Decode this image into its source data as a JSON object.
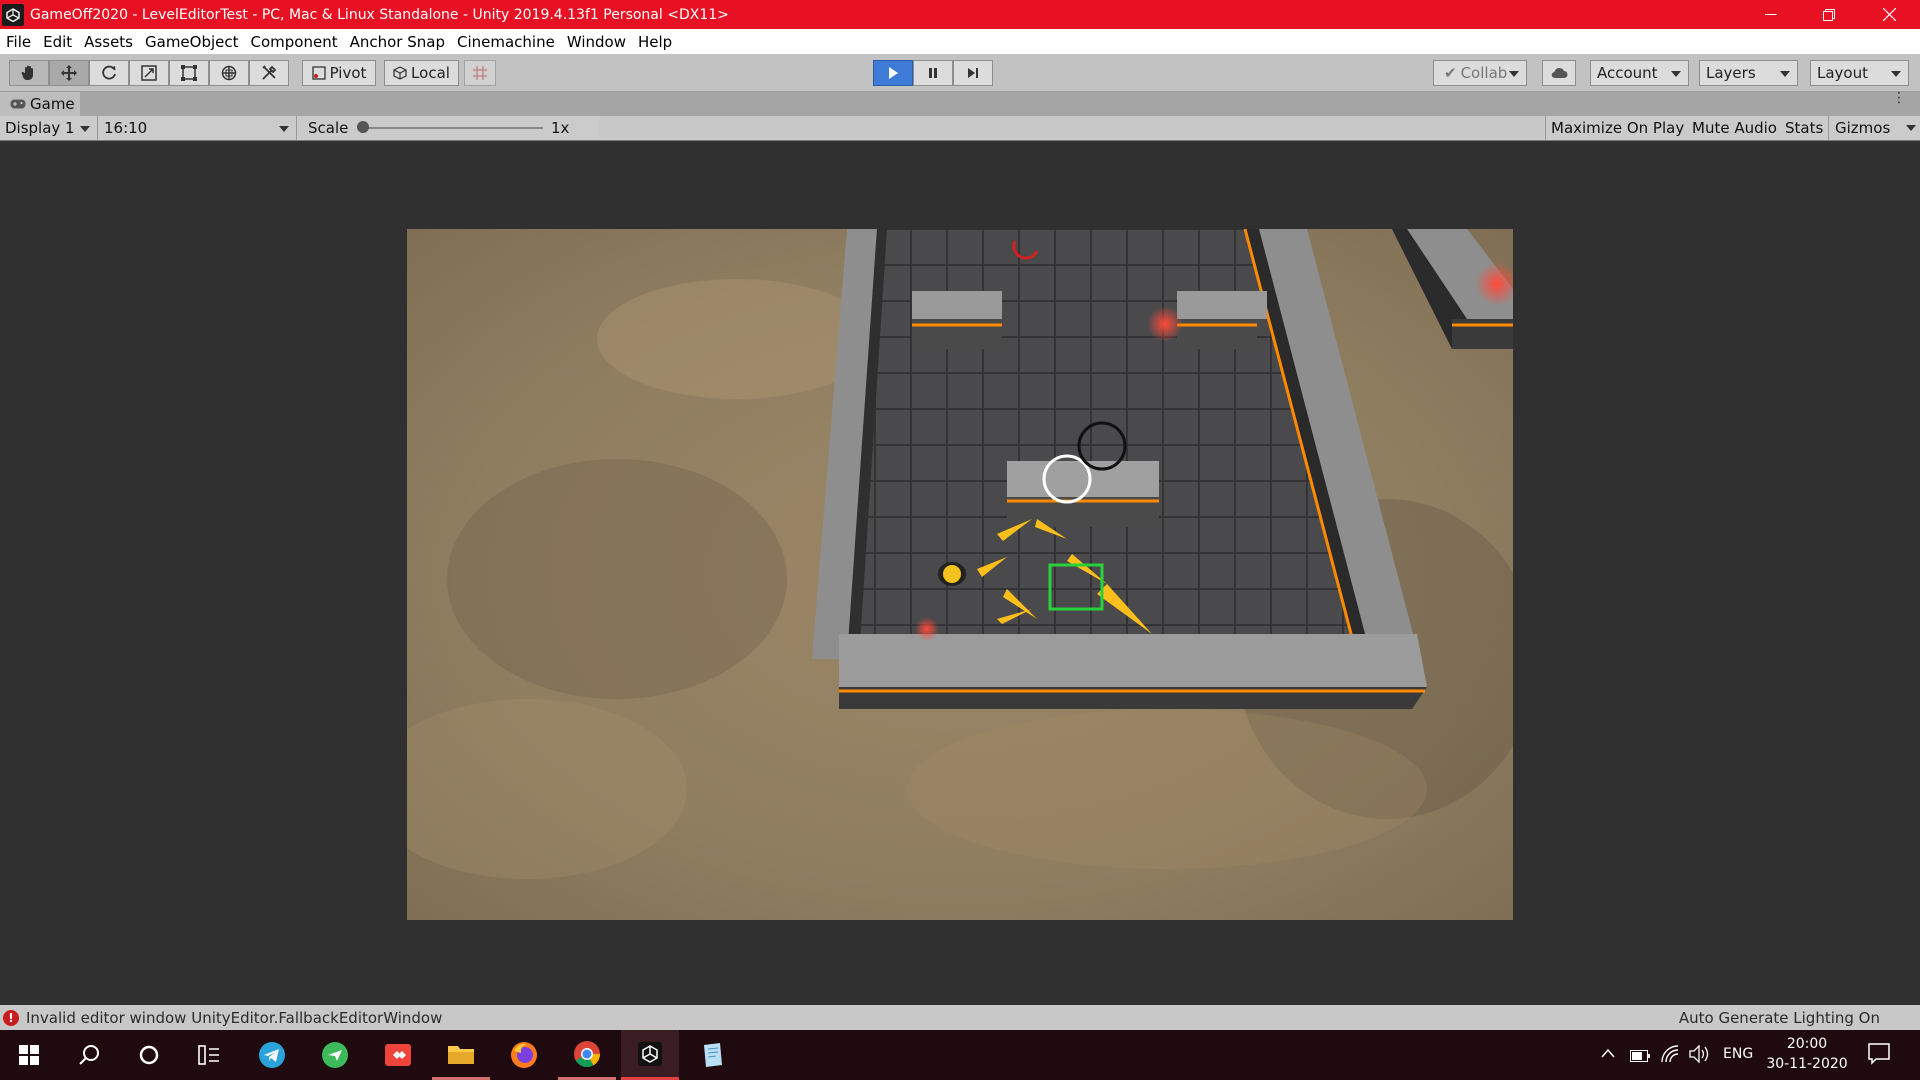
{
  "window": {
    "title": "GameOff2020 - LevelEditorTest - PC, Mac & Linux Standalone - Unity 2019.4.13f1 Personal <DX11>",
    "title_bar_color": "#e81123"
  },
  "menu": [
    "File",
    "Edit",
    "Assets",
    "GameObject",
    "Component",
    "Anchor Snap",
    "Cinemachine",
    "Window",
    "Help"
  ],
  "toolbar": {
    "tools": [
      "hand-icon",
      "move-icon",
      "rotate-icon",
      "scale-icon",
      "rect-tool-icon",
      "transform-icon",
      "custom-tool-icon"
    ],
    "pivot_label": "Pivot",
    "local_label": "Local",
    "collab_label": "Collab",
    "account_label": "Account",
    "layers_label": "Layers",
    "layout_label": "Layout",
    "play_color": "#3d7bd6"
  },
  "game_tab": {
    "label": "Game",
    "display": "Display 1",
    "aspect": "16:10",
    "scale_label": "Scale",
    "scale_value": "1x",
    "maximize": "Maximize On Play",
    "mute": "Mute Audio",
    "stats": "Stats",
    "gizmos": "Gizmos"
  },
  "status": {
    "error": "Invalid editor window UnityEditor.FallbackEditorWindow",
    "lighting": "Auto Generate Lighting On"
  },
  "taskbar": {
    "apps": [
      "windows-start-icon",
      "search-icon",
      "cortana-icon",
      "task-view-icon",
      "telegram-icon",
      "messenger-icon",
      "anydesk-icon",
      "file-explorer-icon",
      "firefox-icon",
      "chrome-icon",
      "unity-icon",
      "notepad-icon"
    ],
    "lang": "ENG",
    "time": "20:00",
    "date": "30-11-2020"
  }
}
